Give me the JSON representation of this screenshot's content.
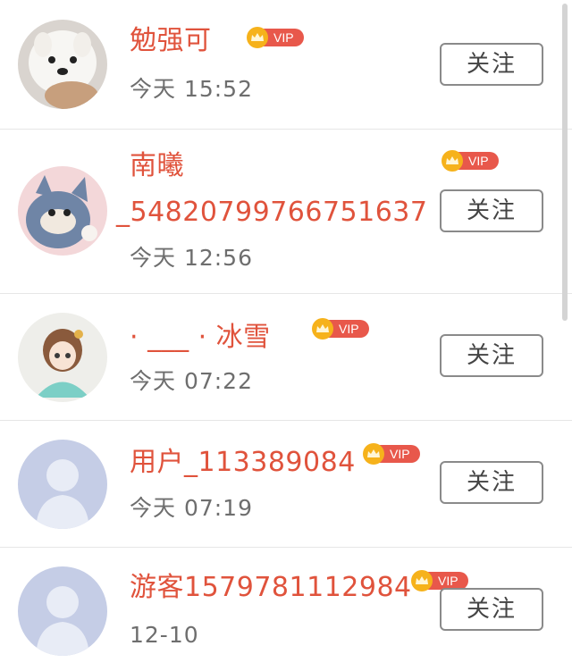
{
  "follow_label": "关注",
  "vip_label": "VIP",
  "users": [
    {
      "name": "勉强可",
      "time": "今天 15:52",
      "avatar": "white-dog-photo"
    },
    {
      "name_line1": "南曦",
      "name_line2": "_54820799766751637",
      "time": "今天 12:56",
      "avatar": "cartoon-cat-photo"
    },
    {
      "name": "· ___ · 冰雪",
      "time": "今天 07:22",
      "avatar": "anime-girl-photo"
    },
    {
      "name": "用户_113389084",
      "time": "今天 07:19",
      "avatar": "default-user-avatar"
    },
    {
      "name": "游客1579781112984",
      "time": "12-10",
      "avatar": "default-user-avatar"
    }
  ],
  "colors": {
    "name": "#e0533c",
    "vip": "#e8584b",
    "crown": "#f6b21b"
  }
}
